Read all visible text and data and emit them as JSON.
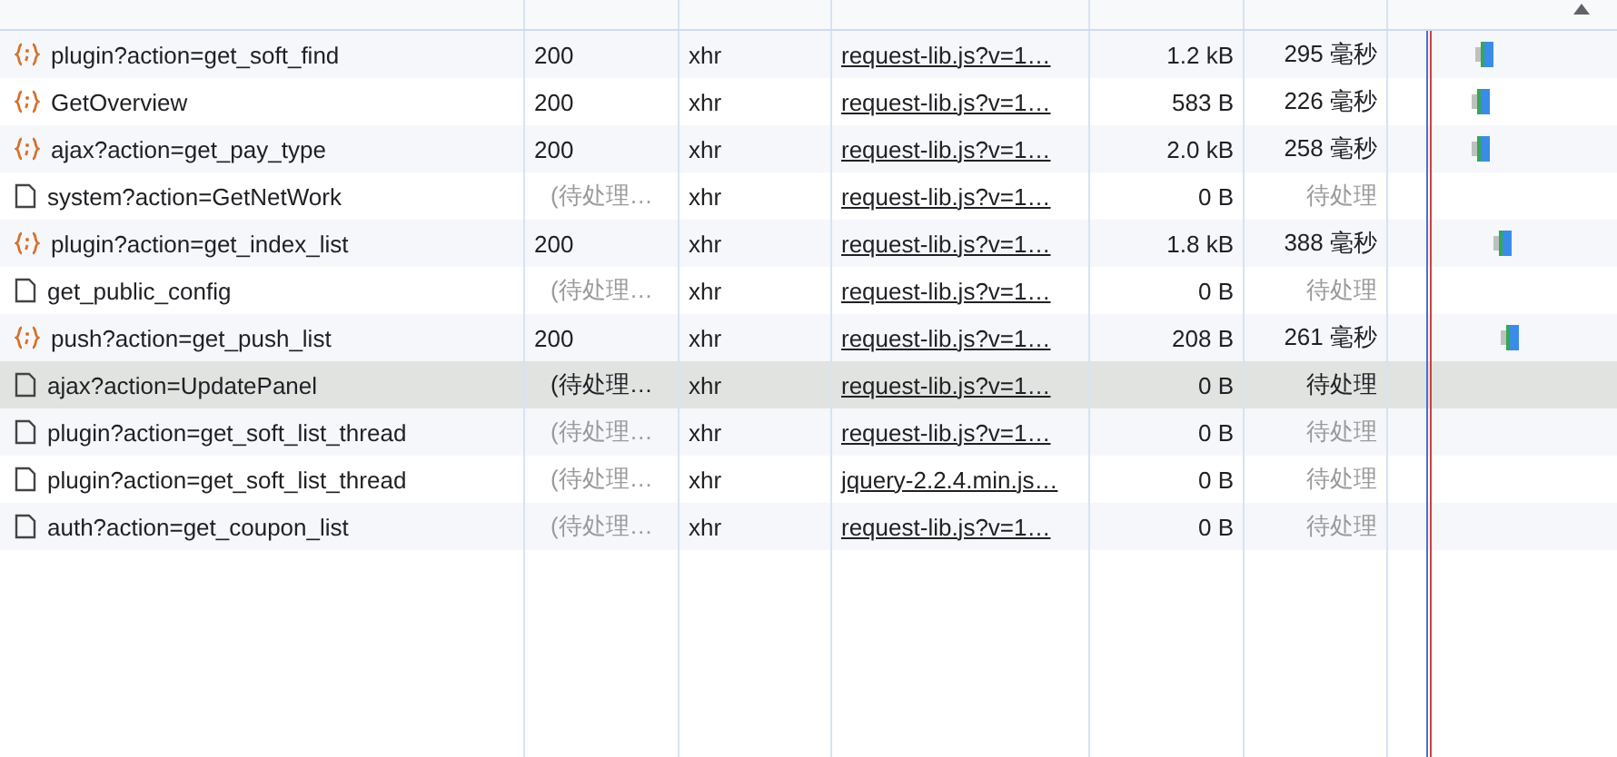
{
  "rows": [
    {
      "kind": "json",
      "name": "plugin?action=get_soft_find",
      "status": "200",
      "status_pending": false,
      "type": "xhr",
      "initiator": "request-lib.js?v=1…",
      "size": "1.2 kB",
      "time": "295 毫秒",
      "selected": false
    },
    {
      "kind": "json",
      "name": "GetOverview",
      "status": "200",
      "status_pending": false,
      "type": "xhr",
      "initiator": "request-lib.js?v=1…",
      "size": "583 B",
      "time": "226 毫秒",
      "selected": false
    },
    {
      "kind": "json",
      "name": "ajax?action=get_pay_type",
      "status": "200",
      "status_pending": false,
      "type": "xhr",
      "initiator": "request-lib.js?v=1…",
      "size": "2.0 kB",
      "time": "258 毫秒",
      "selected": false
    },
    {
      "kind": "document",
      "name": "system?action=GetNetWork",
      "status": "(待处理…",
      "status_pending": true,
      "type": "xhr",
      "initiator": "request-lib.js?v=1…",
      "size": "0 B",
      "time": "待处理",
      "selected": false
    },
    {
      "kind": "json",
      "name": "plugin?action=get_index_list",
      "status": "200",
      "status_pending": false,
      "type": "xhr",
      "initiator": "request-lib.js?v=1…",
      "size": "1.8 kB",
      "time": "388 毫秒",
      "selected": false
    },
    {
      "kind": "document",
      "name": "get_public_config",
      "status": "(待处理…",
      "status_pending": true,
      "type": "xhr",
      "initiator": "request-lib.js?v=1…",
      "size": "0 B",
      "time": "待处理",
      "selected": false
    },
    {
      "kind": "json",
      "name": "push?action=get_push_list",
      "status": "200",
      "status_pending": false,
      "type": "xhr",
      "initiator": "request-lib.js?v=1…",
      "size": "208 B",
      "time": "261 毫秒",
      "selected": false
    },
    {
      "kind": "document",
      "name": "ajax?action=UpdatePanel",
      "status": "(待处理…",
      "status_pending": true,
      "type": "xhr",
      "initiator": "request-lib.js?v=1…",
      "size": "0 B",
      "time": "待处理",
      "selected": true
    },
    {
      "kind": "document",
      "name": "plugin?action=get_soft_list_thread",
      "status": "(待处理…",
      "status_pending": true,
      "type": "xhr",
      "initiator": "request-lib.js?v=1…",
      "size": "0 B",
      "time": "待处理",
      "selected": false
    },
    {
      "kind": "document",
      "name": "plugin?action=get_soft_list_thread",
      "status": "(待处理…",
      "status_pending": true,
      "type": "xhr",
      "initiator": "jquery-2.2.4.min.js…",
      "size": "0 B",
      "time": "待处理",
      "selected": false
    },
    {
      "kind": "document",
      "name": "auth?action=get_coupon_list",
      "status": "(待处理…",
      "status_pending": true,
      "type": "xhr",
      "initiator": "request-lib.js?v=1…",
      "size": "0 B",
      "time": "待处理",
      "selected": false
    }
  ]
}
